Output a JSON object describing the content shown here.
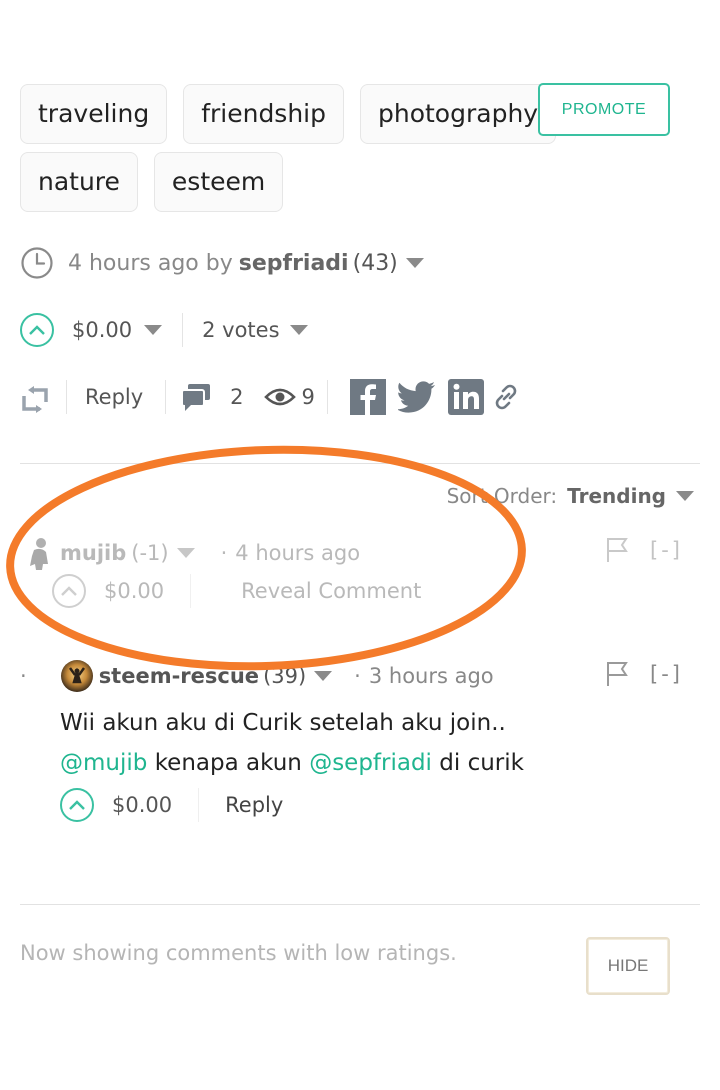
{
  "tags": {
    "row1": [
      "traveling",
      "friendship",
      "photography"
    ],
    "row2": [
      "nature",
      "esteem"
    ],
    "promote_label": "PROMOTE"
  },
  "post_meta": {
    "time": "4 hours ago by",
    "author": "sepfriadi",
    "reputation": "(43)"
  },
  "post_votes": {
    "payout": "$0.00",
    "votes": "2 votes"
  },
  "post_actions": {
    "reply": "Reply",
    "comments_count": "2",
    "views_count": "9"
  },
  "sort": {
    "label": "Sort Order:",
    "value": "Trending"
  },
  "comments": [
    {
      "author": "mujib",
      "reputation": "(-1)",
      "time": "4 hours ago",
      "payout": "$0.00",
      "action": "Reveal Comment",
      "collapse": "[-]"
    },
    {
      "author": "steem-rescue",
      "reputation": "(39)",
      "time": "3 hours ago",
      "body_line1": "Wii akun aku di Curik setelah aku join..",
      "mention1": "@mujib",
      "body_mid": "kenapa akun",
      "mention2": "@sepfriadi",
      "body_end": "di curik",
      "payout": "$0.00",
      "action": "Reply",
      "collapse": "[-]"
    }
  ],
  "footer": {
    "notice": "Now showing comments with low ratings.",
    "hide_label": "HIDE"
  },
  "colors": {
    "accent": "#1fb58f",
    "annotation": "#f47b2a"
  }
}
